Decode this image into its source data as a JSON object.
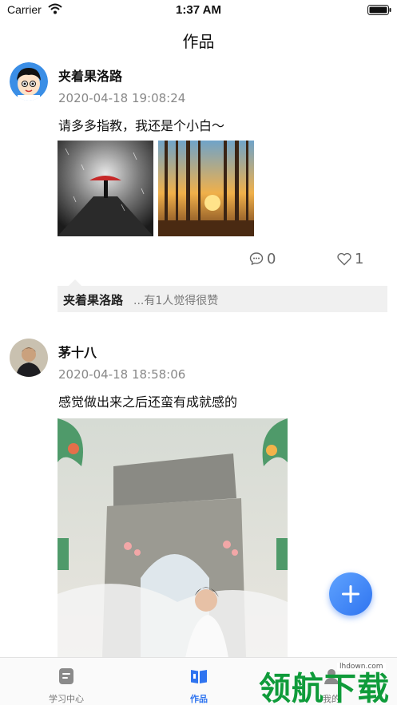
{
  "status_bar": {
    "carrier": "Carrier",
    "time": "1:37 AM"
  },
  "nav": {
    "title": "作品"
  },
  "posts": [
    {
      "author": "夹着果洛路",
      "timestamp": "2020-04-18 19:08:24",
      "content": "请多多指教，我还是个小白～",
      "comment_count": "0",
      "like_count": "1",
      "like_summary": {
        "user": "夹着果洛路",
        "text": "...有1人觉得很赞"
      }
    },
    {
      "author": "茅十八",
      "timestamp": "2020-04-18 18:58:06",
      "content": "感觉做出来之后还蛮有成就感的"
    }
  ],
  "tabs": [
    {
      "label": "学习中心",
      "icon": "note-icon"
    },
    {
      "label": "作品",
      "icon": "book-icon"
    },
    {
      "label": "我的",
      "icon": "user-icon"
    }
  ],
  "watermark": {
    "text": "领航下载",
    "url": "lhdown.com"
  },
  "colors": {
    "accent": "#2f74f0",
    "watermark": "#0f9b3a"
  }
}
